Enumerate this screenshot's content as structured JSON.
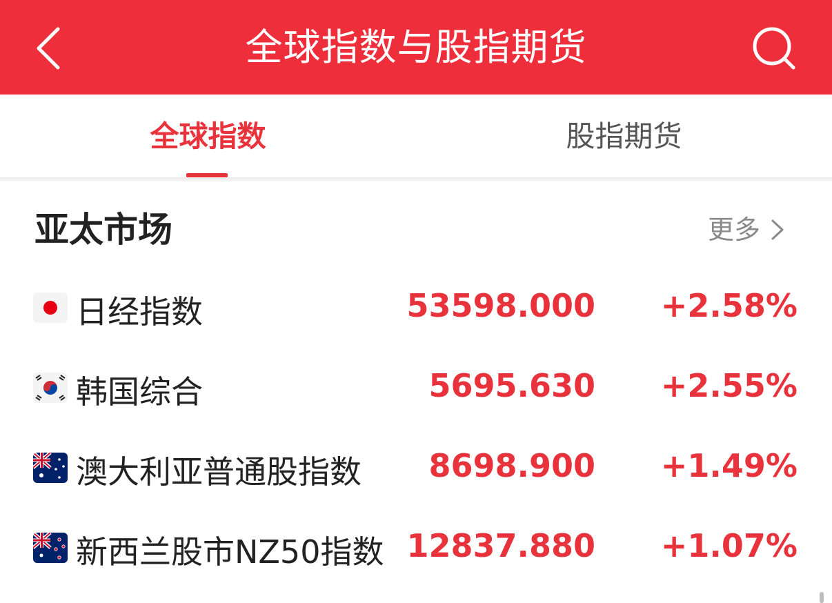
{
  "header": {
    "title": "全球指数与股指期货",
    "back_icon": "chevron-left-icon",
    "search_icon": "search-icon"
  },
  "tabs": [
    {
      "label": "全球指数",
      "active": true
    },
    {
      "label": "股指期货",
      "active": false
    }
  ],
  "section": {
    "title": "亚太市场",
    "more_label": "更多",
    "more_icon": "chevron-right-icon"
  },
  "indices": [
    {
      "flag": "japan-flag-icon",
      "name": "日经指数",
      "value": "53598.000",
      "change": "+2.58%"
    },
    {
      "flag": "south-korea-flag-icon",
      "name": "韩国综合",
      "value": "5695.630",
      "change": "+2.55%"
    },
    {
      "flag": "australia-flag-icon",
      "name": "澳大利亚普通股指数",
      "value": "8698.900",
      "change": "+1.49%"
    },
    {
      "flag": "new-zealand-flag-icon",
      "name": "新西兰股市NZ50指数",
      "value": "12837.880",
      "change": "+1.07%"
    }
  ],
  "colors": {
    "brand_red": "#ee2f3b",
    "up_red": "#e8323c",
    "text_dark": "#222222",
    "text_muted": "#8a8a8a"
  }
}
